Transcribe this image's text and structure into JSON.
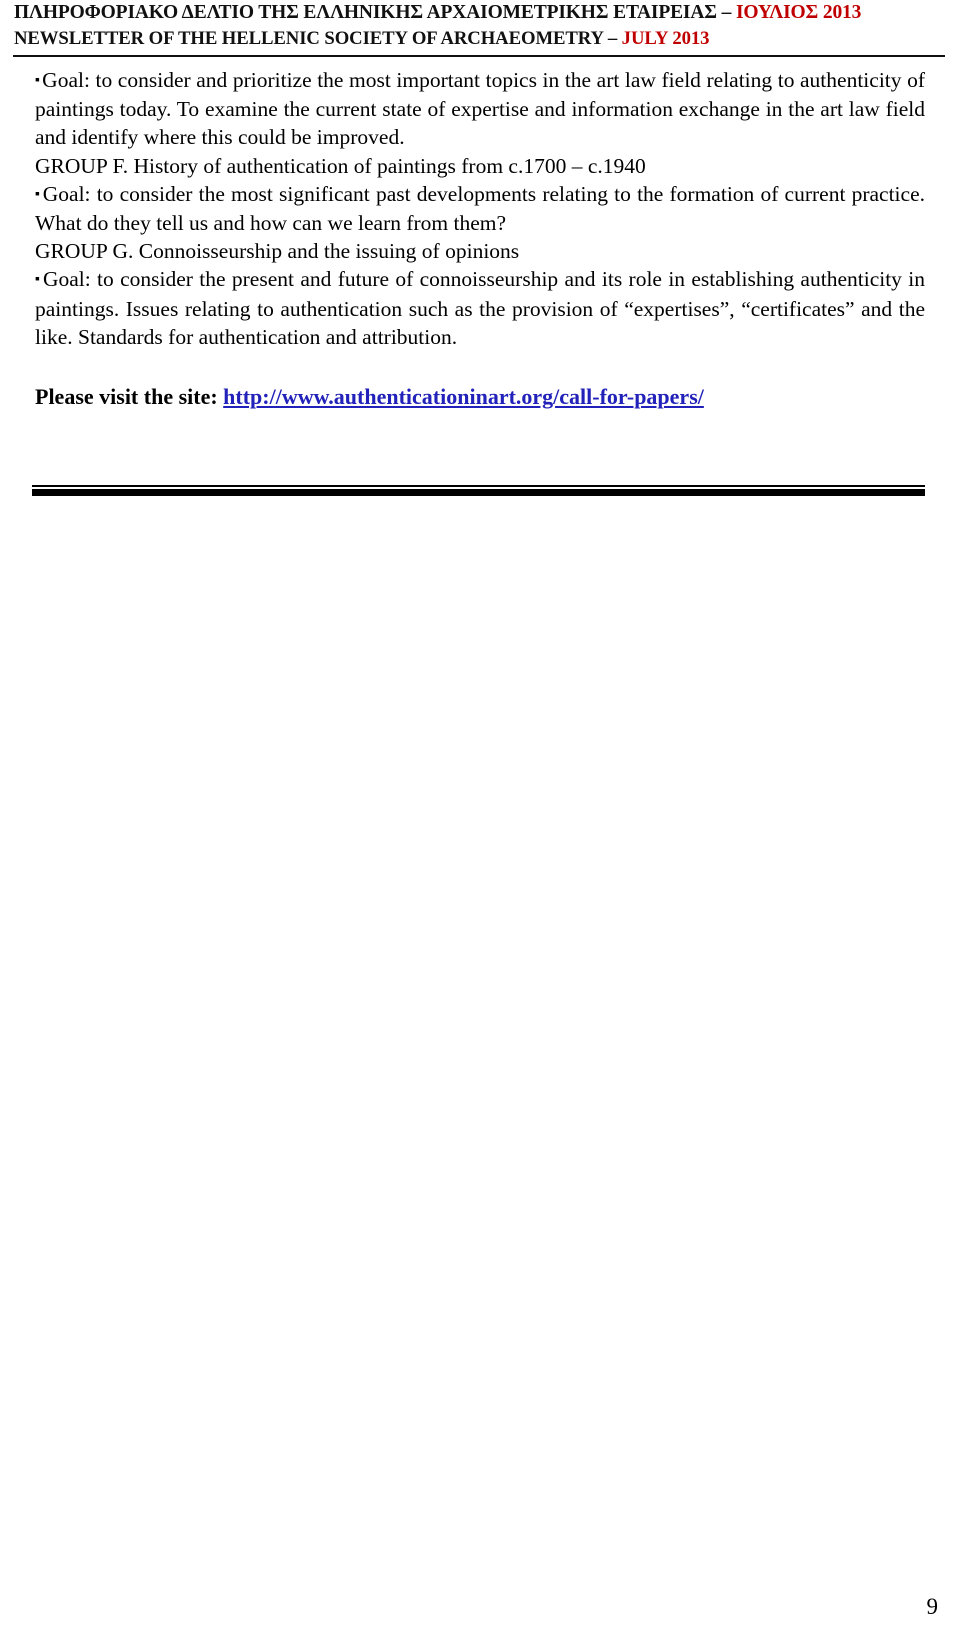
{
  "header": {
    "line1_prefix": "ΠΛΗΡΟΦΟΡΙΑΚΟ ΔΕΛΤΙΟ ΤΗΣ ΕΛΛΗΝΙΚΗΣ ΑΡΧΑΙΟΜΕΤΡΙΚΗΣ ΕΤΑΙΡΕΙΑΣ – ",
    "line1_highlight": "ΙΟΥΛΙΟΣ 2013",
    "line2_prefix": "NEWSLETTER OF THE HELLENIC SOCIETY OF ARCHAEOMETRY – ",
    "line2_highlight": "JULY 2013",
    "highlight_color": "#c00000"
  },
  "body": {
    "bullet_glyph": "▪",
    "paragraph_1": "Goal: to consider and prioritize the most important topics in the art law field relating to authenticity of paintings today. To examine the current state of expertise and information exchange in the art law field and identify where this could be improved.",
    "group_f_heading": "GROUP F. History of authentication of paintings from c.1700 – c.1940",
    "paragraph_2": "Goal: to consider the most significant past developments relating to the formation of current practice. What do they tell us and how can we learn from them?",
    "group_g_heading": "GROUP G. Connoisseurship and the issuing of opinions",
    "paragraph_3": "Goal: to consider the present and future of connoisseurship and its role in establishing authenticity in paintings. Issues relating to authentication such as the provision of “expertises”, “certificates” and the like. Standards for authentication and attribution."
  },
  "link_section": {
    "label": "Please visit the site: ",
    "url_text": "http://www.authenticationinart.org/call-for-papers/",
    "url_color": "#2222bb"
  },
  "footer": {
    "page_number": "9"
  }
}
